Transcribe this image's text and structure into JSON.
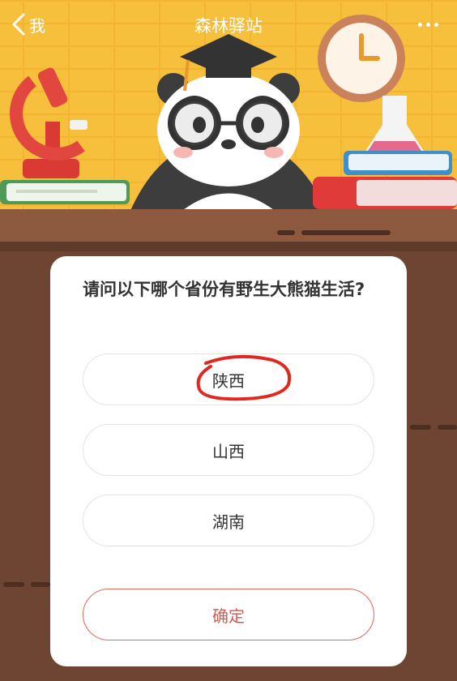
{
  "nav": {
    "back_label": "我",
    "title": "森林驿站"
  },
  "quiz": {
    "question": "请问以下哪个省份有野生大熊猫生活?",
    "options": [
      {
        "label": "陕西",
        "marked": true
      },
      {
        "label": "山西",
        "marked": false
      },
      {
        "label": "湖南",
        "marked": false
      }
    ],
    "confirm_label": "确定"
  },
  "colors": {
    "banner_bg": "#f6bf3c",
    "desk": "#6e4532",
    "confirm_accent": "#d9584a",
    "scribble": "#e0281e"
  },
  "icons": [
    "chevron-left-icon",
    "more-dots-icon",
    "microscope-icon",
    "panda-graduate-icon",
    "clock-icon",
    "flask-icon",
    "books-icon"
  ]
}
